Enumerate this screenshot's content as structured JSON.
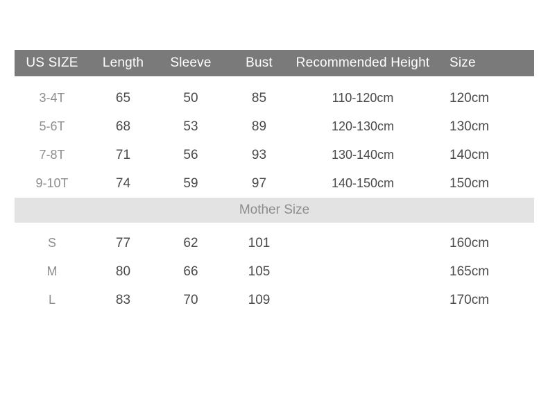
{
  "table": {
    "columns": [
      {
        "key": "us_size",
        "label": "US SIZE",
        "align": "center"
      },
      {
        "key": "length",
        "label": "Length",
        "align": "center"
      },
      {
        "key": "sleeve",
        "label": "Sleeve",
        "align": "center"
      },
      {
        "key": "bust",
        "label": "Bust",
        "align": "center"
      },
      {
        "key": "recommended_height",
        "label": "Recommended Height",
        "align": "center"
      },
      {
        "key": "size",
        "label": "Size",
        "align": "left"
      }
    ],
    "header": {
      "us_size": "US SIZE",
      "length": "Length",
      "sleeve": "Sleeve",
      "bust": "Bust",
      "recommended_height": "Recommended Height",
      "size": "Size"
    },
    "kids_rows": [
      {
        "us_size": "3-4T",
        "length": "65",
        "sleeve": "50",
        "bust": "85",
        "recommended_height": "110-120cm",
        "size": "120cm"
      },
      {
        "us_size": "5-6T",
        "length": "68",
        "sleeve": "53",
        "bust": "89",
        "recommended_height": "120-130cm",
        "size": "130cm"
      },
      {
        "us_size": "7-8T",
        "length": "71",
        "sleeve": "56",
        "bust": "93",
        "recommended_height": "130-140cm",
        "size": "140cm"
      },
      {
        "us_size": "9-10T",
        "length": "74",
        "sleeve": "59",
        "bust": "97",
        "recommended_height": "140-150cm",
        "size": "150cm"
      }
    ],
    "section_divider": {
      "label": "Mother Size"
    },
    "mother_rows": [
      {
        "us_size": "S",
        "length": "77",
        "sleeve": "62",
        "bust": "101",
        "recommended_height": "",
        "size": "160cm"
      },
      {
        "us_size": "M",
        "length": "80",
        "sleeve": "66",
        "bust": "105",
        "recommended_height": "",
        "size": "165cm"
      },
      {
        "us_size": "L",
        "length": "83",
        "sleeve": "70",
        "bust": "109",
        "recommended_height": "",
        "size": "170cm"
      }
    ]
  },
  "colors": {
    "header_band": "#7a7a7a",
    "header_text": "#ffffff",
    "section_band": "#e3e3e3",
    "section_text": "#8d8d8d",
    "value_text": "#4a4a4a",
    "size_label_text": "#8d8d8d",
    "background": "#ffffff"
  }
}
